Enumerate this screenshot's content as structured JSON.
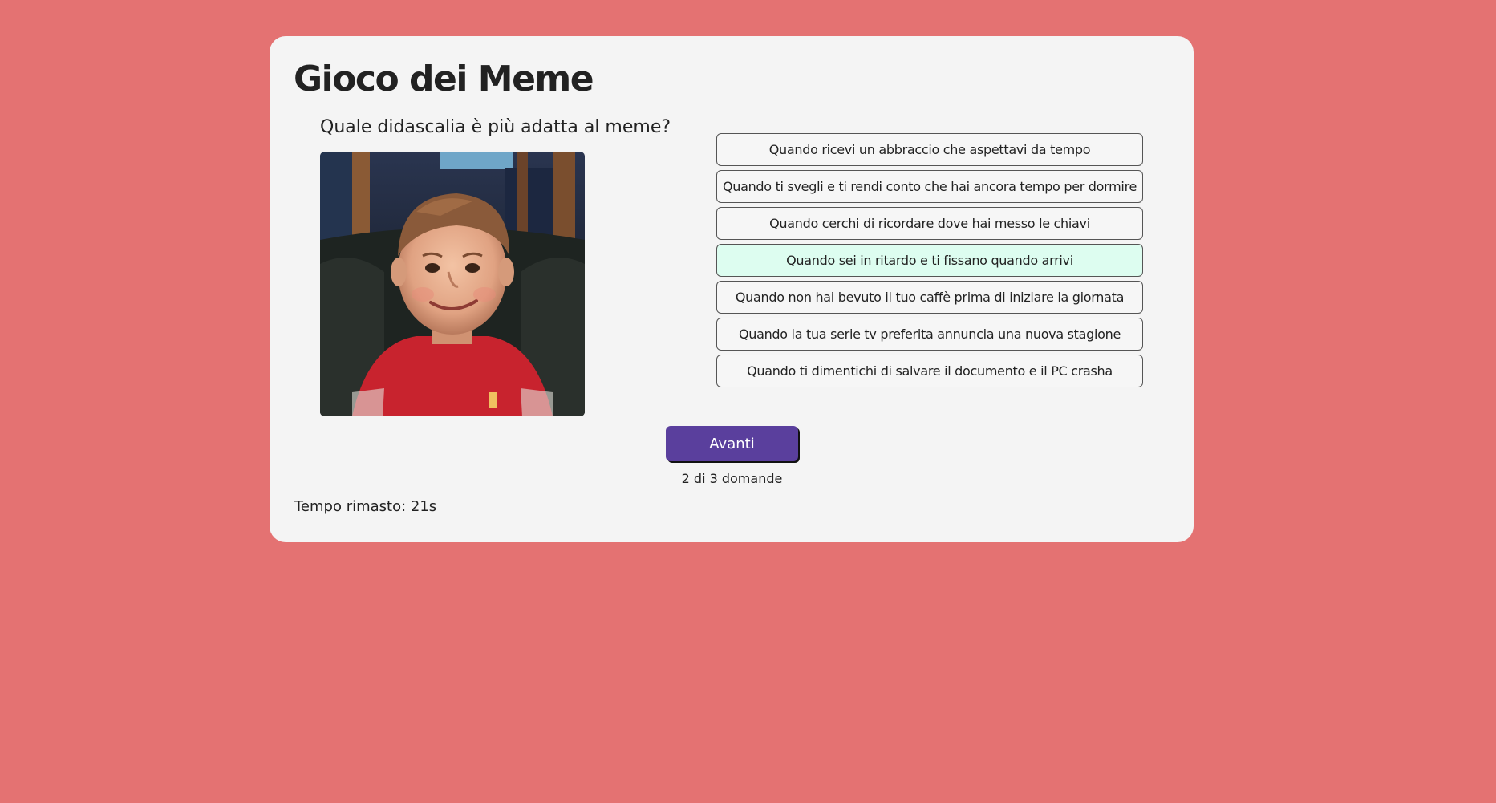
{
  "game": {
    "title": "Gioco dei Meme",
    "question": "Quale didascalia è più adatta al meme?",
    "options": [
      "Quando ricevi un abbraccio che aspettavi da tempo",
      "Quando ti svegli e ti rendi conto che hai ancora tempo per dormire",
      "Quando cerchi di ricordare dove hai messo le chiavi",
      "Quando sei in ritardo e ti fissano quando arrivi",
      "Quando non hai bevuto il tuo caffè prima di iniziare la giornata",
      "Quando la tua serie tv preferita annuncia una nuova stagione",
      "Quando ti dimentichi di salvare il documento e il PC crasha"
    ],
    "selected_option_index": 3,
    "next_label": "Avanti",
    "progress": "2 di 3 domande",
    "timer": "Tempo rimasto: 21s"
  },
  "colors": {
    "background": "#e47272",
    "card": "#f4f4f4",
    "button": "#5a3f9d",
    "selected_option": "#ddfdf0"
  }
}
